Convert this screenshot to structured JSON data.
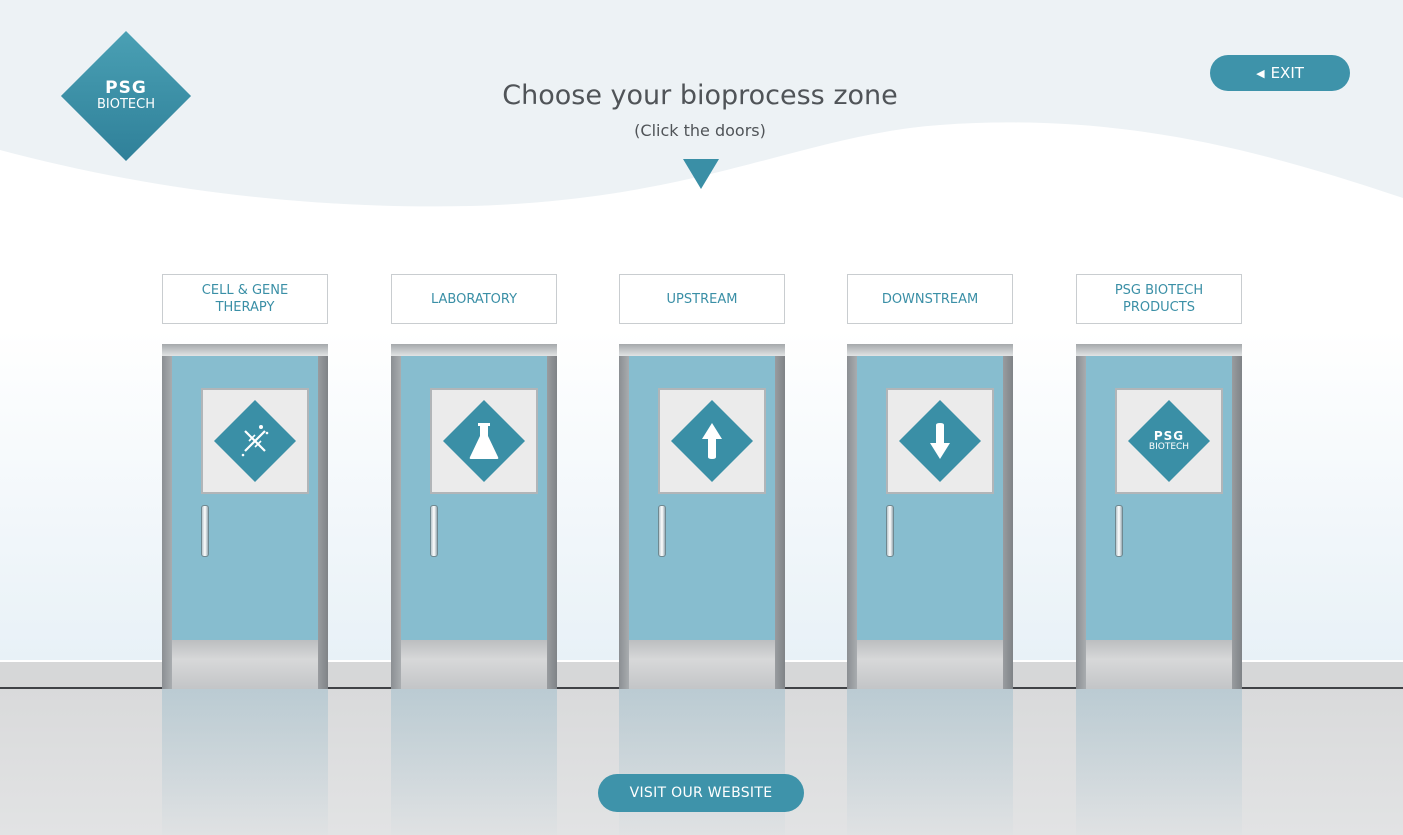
{
  "logo": {
    "line1": "PSG",
    "line2": "BIOTECH"
  },
  "header": {
    "title": "Choose your bioprocess zone",
    "subtitle": "(Click the doors)"
  },
  "exit": {
    "label": "EXIT",
    "icon": "triangle-left-icon"
  },
  "zones": [
    {
      "label": "CELL & GENE THERAPY",
      "icon": "dna-icon"
    },
    {
      "label": "LABORATORY",
      "icon": "flask-icon"
    },
    {
      "label": "UPSTREAM",
      "icon": "arrow-up-icon"
    },
    {
      "label": "DOWNSTREAM",
      "icon": "arrow-down-icon"
    },
    {
      "label": "PSG BIOTECH PRODUCTS",
      "icon": "psg-biotech-logo-icon",
      "window_logo": {
        "line1": "PSG",
        "line2": "BIOTECH"
      }
    }
  ],
  "footer": {
    "visit_label": "VISIT OUR WEBSITE"
  },
  "colors": {
    "accent": "#3E93AA",
    "door": "#87BDCF",
    "text": "#505458",
    "wave": "#EDF2F5"
  }
}
